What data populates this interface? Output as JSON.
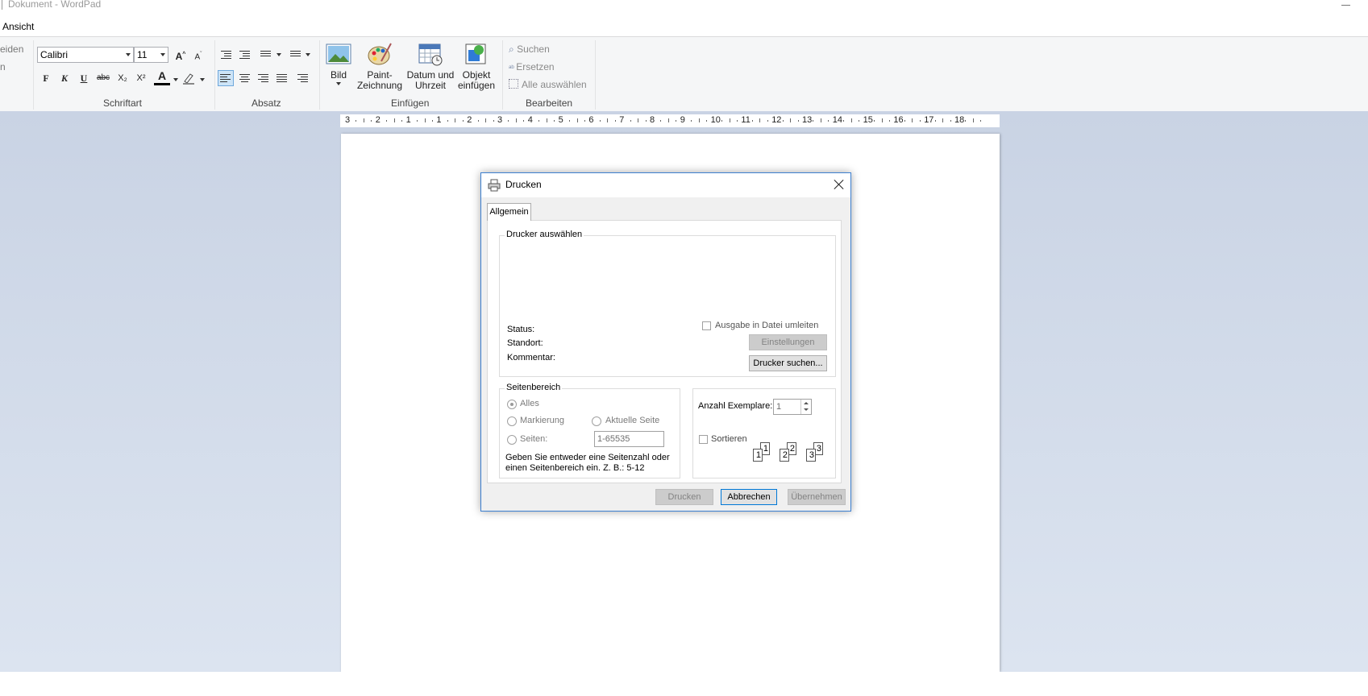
{
  "window": {
    "title": "Dokument - WordPad"
  },
  "menu": {
    "partial_left_tab": "Ansicht"
  },
  "ribbon": {
    "clipboard_partial": [
      "eiden",
      "n"
    ],
    "font": {
      "family": "Calibri",
      "size": "11",
      "format_buttons": [
        "F",
        "K",
        "U",
        "abc",
        "X₂",
        "X²",
        "A"
      ],
      "group_label": "Schriftart"
    },
    "paragraph": {
      "group_label": "Absatz"
    },
    "insert": {
      "group_label": "Einfügen",
      "buttons": [
        {
          "label": "Bild",
          "icon": "picture-icon"
        },
        {
          "label": "Paint-\nZeichnung",
          "icon": "paint-palette-icon"
        },
        {
          "label": "Datum und\nUhrzeit",
          "icon": "calendar-clock-icon"
        },
        {
          "label": "Objekt\neinfügen",
          "icon": "insert-object-icon"
        }
      ]
    },
    "edit": {
      "group_label": "Bearbeiten",
      "find": "Suchen",
      "replace": "Ersetzen",
      "select_all": "Alle auswählen"
    }
  },
  "ruler": {
    "numbers": [
      "3",
      "2",
      "1",
      "1",
      "2",
      "3",
      "4",
      "5",
      "6",
      "7",
      "8",
      "9",
      "10",
      "11",
      "12",
      "13",
      "14",
      "15",
      "16",
      "17",
      "18"
    ]
  },
  "dialog": {
    "title": "Drucken",
    "tab": "Allgemein",
    "printer_group": {
      "label": "Drucker auswählen",
      "status": "Status:",
      "location": "Standort:",
      "comment": "Kommentar:",
      "print_to_file": "Ausgabe in Datei umleiten",
      "settings_button": "Einstellungen",
      "find_printer_button": "Drucker suchen..."
    },
    "page_range": {
      "label": "Seitenbereich",
      "all": "Alles",
      "selection": "Markierung",
      "current_page": "Aktuelle Seite",
      "pages": "Seiten:",
      "pages_value": "1-65535",
      "hint": "Geben Sie entweder eine Seitenzahl oder einen Seitenbereich ein. Z. B.: 5-12"
    },
    "copies": {
      "label": "Anzahl Exemplare:",
      "value": "1",
      "collate": "Sortieren",
      "collate_pages": [
        "1",
        "1",
        "2",
        "2",
        "3",
        "3"
      ]
    },
    "buttons": {
      "print": "Drucken",
      "cancel": "Abbrechen",
      "apply": "Übernehmen"
    }
  }
}
